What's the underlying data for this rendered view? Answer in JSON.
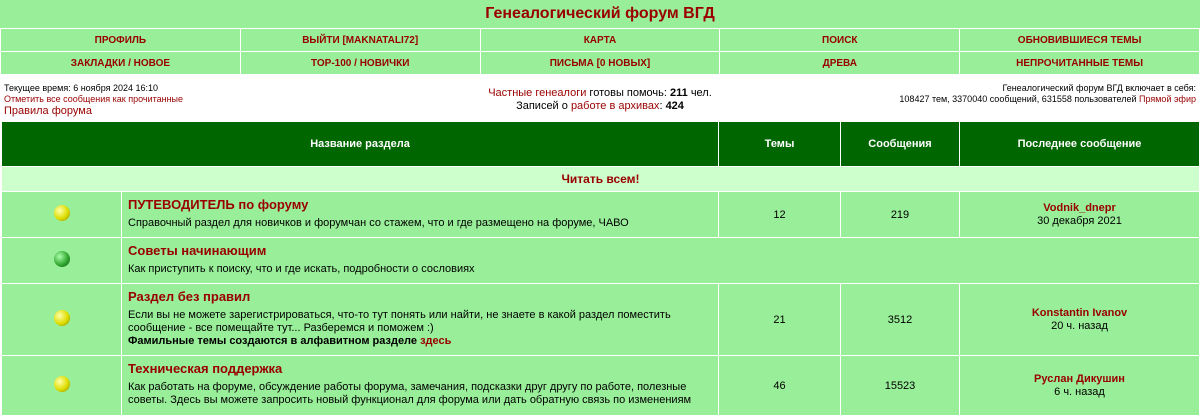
{
  "site_title": "Генеалогический форум ВГД",
  "nav": {
    "row1": [
      "ПРОФИЛЬ",
      "ВЫЙТИ [MAKNATALI72]",
      "КАРТА",
      "ПОИСК",
      "ОБНОВИВШИЕСЯ ТЕМЫ"
    ],
    "row2": [
      "ЗАКЛАДКИ / НОВОЕ",
      "TOP-100 / НОВИЧКИ",
      "ПИСЬМА [0 НОВЫХ]",
      "ДРЕВА",
      "НЕПРОЧИТАННЫЕ ТЕМЫ"
    ]
  },
  "info": {
    "current_time": "Текущее время: 6 ноября 2024 16:10",
    "mark_read": "Отметить все сообщения как прочитанные",
    "rules": "Правила форума",
    "center_line1_link": "Частные генеалоги",
    "center_line1_text": " готовы помочь: ",
    "center_line1_count": "211",
    "center_line1_unit": " чел.",
    "center_line2_text": "Записей о ",
    "center_line2_link": "работе в архивах",
    "center_line2_sep": ": ",
    "center_line2_count": "424",
    "right_line1": "Генеалогический форум ВГД включает в себя:",
    "right_line2": "108427 тем, 3370040 сообщений, 631558 пользователей ",
    "right_link": "Прямой эфир"
  },
  "table": {
    "headers": {
      "name": "Название раздела",
      "topics": "Темы",
      "posts": "Сообщения",
      "last": "Последнее сообщение"
    },
    "category": "Читать всем!",
    "forums": [
      {
        "title": "ПУТЕВОДИТЕЛЬ по форуму",
        "desc": "Справочный раздел для новичков и форумчан со стажем, что и где размещено на форуме, ЧАВО",
        "topics": "12",
        "posts": "219",
        "last_author": "Vodnik_dnepr",
        "last_date": "30 декабря 2021",
        "icon": "yellow-bulb-icon"
      },
      {
        "title": "Советы начинающим",
        "desc": "Как приступить к поиску, что и где искать, подробности о сословиях",
        "topics": "",
        "posts": "",
        "last_author": "",
        "last_date": "",
        "icon": "green-bulb-icon"
      },
      {
        "title": "Раздел без правил",
        "desc": "Если вы не можете зарегистрироваться, что-то тут понять или найти, не знаете в какой раздел поместить сообщение - все помещайте тут... Разберемся и поможем :)",
        "extra_text": "Фамильные темы создаются в алфавитном разделе ",
        "extra_link": "здесь",
        "topics": "21",
        "posts": "3512",
        "last_author": "Konstantin Ivanov",
        "last_date": "20 ч. назад",
        "icon": "yellow-bulb-icon"
      },
      {
        "title": "Техническая поддержка",
        "desc": "Как работать на форуме, обсуждение работы форума, замечания, подсказки друг другу по работе, полезные советы. Здесь вы можете запросить новый функционал для форума или дать обратную связь по изменениям",
        "topics": "46",
        "posts": "15523",
        "last_author": "Руслан Дикушин",
        "last_date": "6 ч. назад",
        "icon": "yellow-bulb-icon"
      }
    ]
  },
  "colors": {
    "header_green": "#99ee99",
    "dark_green": "#006600",
    "accent_red": "#990000",
    "category_bg": "#ccffcc"
  }
}
